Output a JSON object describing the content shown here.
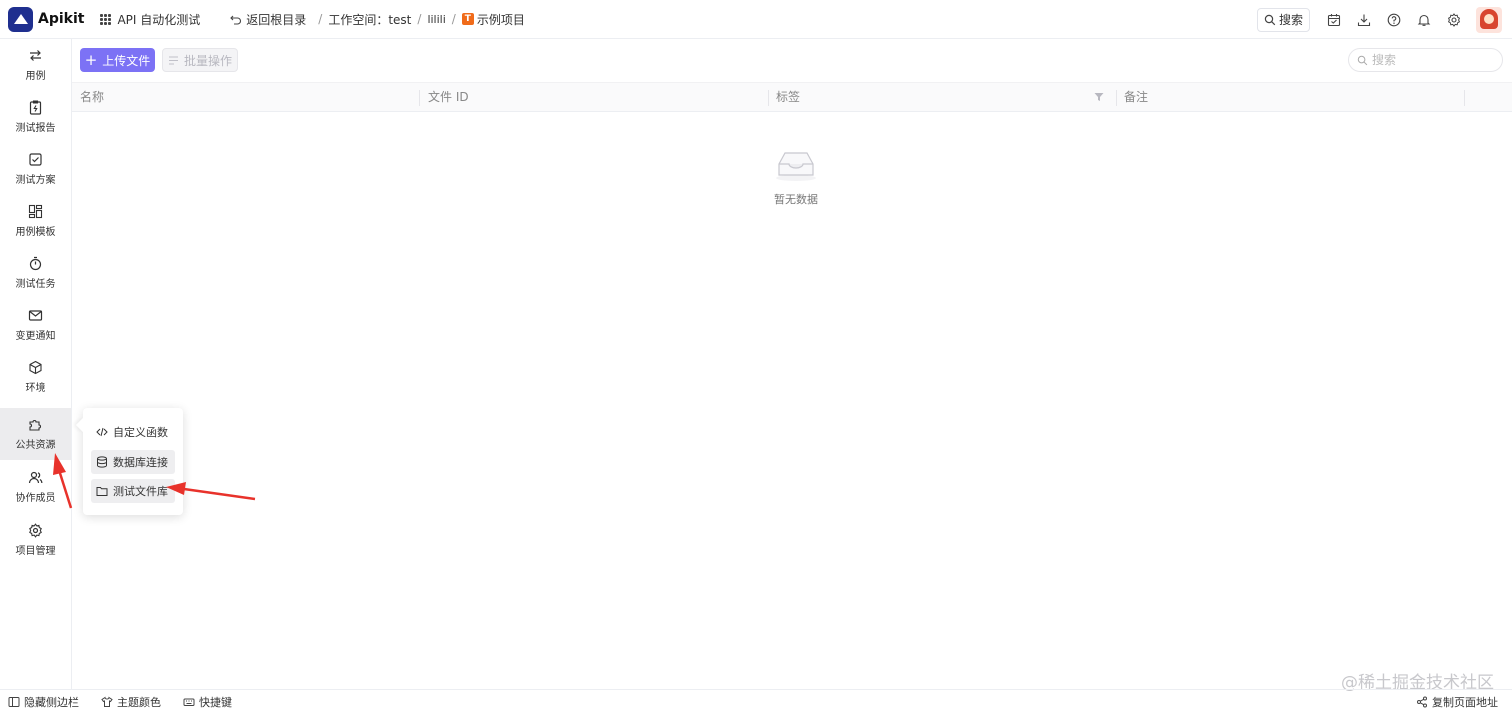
{
  "app": {
    "name": "Apikit"
  },
  "topbar": {
    "module": "API 自动化测试",
    "back": "返回根目录",
    "breadcrumb": [
      "工作空间：test",
      "lilili",
      "示例项目"
    ],
    "search_label": "搜索"
  },
  "sidebar": {
    "items": [
      {
        "label": "用例",
        "icon": "swap-icon"
      },
      {
        "label": "测试报告",
        "icon": "report-icon"
      },
      {
        "label": "测试方案",
        "icon": "checkbox-icon"
      },
      {
        "label": "用例模板",
        "icon": "template-icon"
      },
      {
        "label": "测试任务",
        "icon": "timer-icon"
      },
      {
        "label": "变更通知",
        "icon": "mail-icon"
      },
      {
        "label": "环境",
        "icon": "cube-icon"
      },
      {
        "label": "公共资源",
        "icon": "puzzle-icon",
        "active": true
      },
      {
        "label": "协作成员",
        "icon": "users-icon"
      },
      {
        "label": "项目管理",
        "icon": "gear-icon"
      }
    ]
  },
  "toolbar": {
    "upload_label": "上传文件",
    "batch_label": "批量操作",
    "search_placeholder": "搜索"
  },
  "table": {
    "columns": [
      "名称",
      "文件 ID",
      "标签",
      "备注"
    ],
    "empty_text": "暂无数据"
  },
  "popup": {
    "items": [
      "自定义函数",
      "数据库连接",
      "测试文件库"
    ]
  },
  "footer": {
    "hide_sidebar": "隐藏侧边栏",
    "theme": "主题颜色",
    "shortcuts": "快捷键",
    "copy_url": "复制页面地址"
  },
  "watermark": "@稀土掘金技术社区",
  "colors": {
    "primary": "#7c72f5",
    "brand": "#1f2f8f",
    "annotation_arrow": "#e8322b"
  }
}
